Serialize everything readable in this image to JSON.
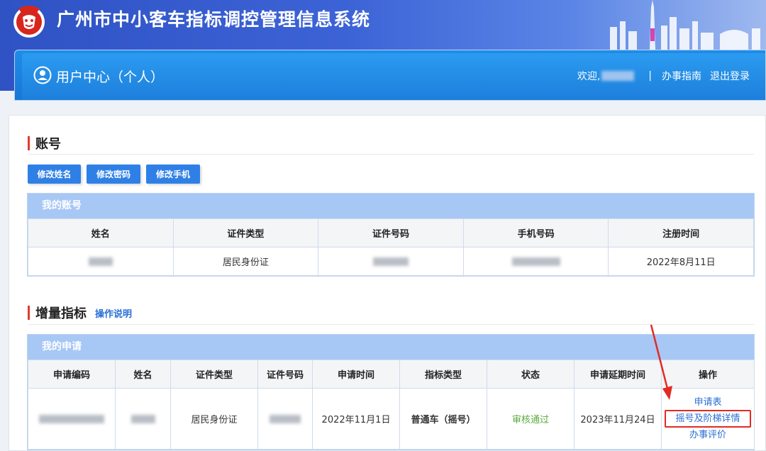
{
  "header": {
    "system_title": "广州市中小客车指标调控管理信息系统",
    "user_center": "用户中心（个人）",
    "welcome": "欢迎,",
    "separator": "|",
    "guide_link": "办事指南",
    "logout_link": "退出登录"
  },
  "account": {
    "section_title": "账号",
    "buttons": [
      "修改姓名",
      "修改密码",
      "修改手机"
    ],
    "table_caption": "我的账号",
    "columns": [
      "姓名",
      "证件类型",
      "证件号码",
      "手机号码",
      "注册时间"
    ],
    "row": {
      "id_type": "居民身份证",
      "reg_time": "2022年8月11日"
    }
  },
  "increment": {
    "section_title": "增量指标",
    "help_link": "操作说明",
    "table_caption": "我的申请",
    "columns": [
      "申请编码",
      "姓名",
      "证件类型",
      "证件号码",
      "申请时间",
      "指标类型",
      "状态",
      "申请延期时间",
      "操作"
    ],
    "row": {
      "id_type": "居民身份证",
      "apply_time": "2022年11月1日",
      "quota_type": "普通车（摇号）",
      "status": "审核通过",
      "extend_time": "2023年11月24日",
      "ops": [
        "申请表",
        "摇号及阶梯详情",
        "办事评价"
      ]
    }
  },
  "colors": {
    "accent_red": "#e23b2f",
    "button_blue": "#2f80e6",
    "caption_blue": "#a7c7f5",
    "link_blue": "#2a6fd6",
    "status_green": "#5aaa3c"
  }
}
